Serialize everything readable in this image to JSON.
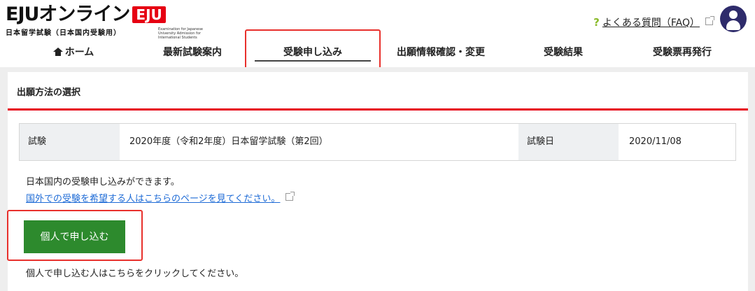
{
  "header": {
    "logo_text": "EJUオンライン",
    "logo_badge": "EJU",
    "logo_subtitle": "日本留学試験（日本国内受験用）",
    "logo_tagline": "Examination for Japanese University Admission for International Students",
    "faq_mark": "?",
    "faq_label": "よくある質問（FAQ）"
  },
  "nav": {
    "items": [
      {
        "label": "ホーム",
        "icon": "home-icon"
      },
      {
        "label": "最新試験案内"
      },
      {
        "label": "受験申し込み",
        "active": true
      },
      {
        "label": "出願情報確認・変更"
      },
      {
        "label": "受験結果"
      },
      {
        "label": "受験票再発行"
      }
    ]
  },
  "main": {
    "section_title": "出願方法の選択",
    "exam_label": "試験",
    "exam_value": "2020年度（令和2年度）日本留学試験（第2回）",
    "date_label": "試験日",
    "date_value": "2020/11/08",
    "description": "日本国内の受験申し込みができます。",
    "overseas_link": "国外での受験を希望する人はこちらのページを見てください。",
    "apply_button": "個人で申し込む",
    "apply_note": "個人で申し込む人はこちらをクリックしてください。"
  },
  "colors": {
    "brand_red": "#e60012",
    "button_green": "#2d8a2d",
    "highlight": "#e8302c",
    "link_blue": "#1e6bd6",
    "avatar_navy": "#2e2b6b"
  }
}
